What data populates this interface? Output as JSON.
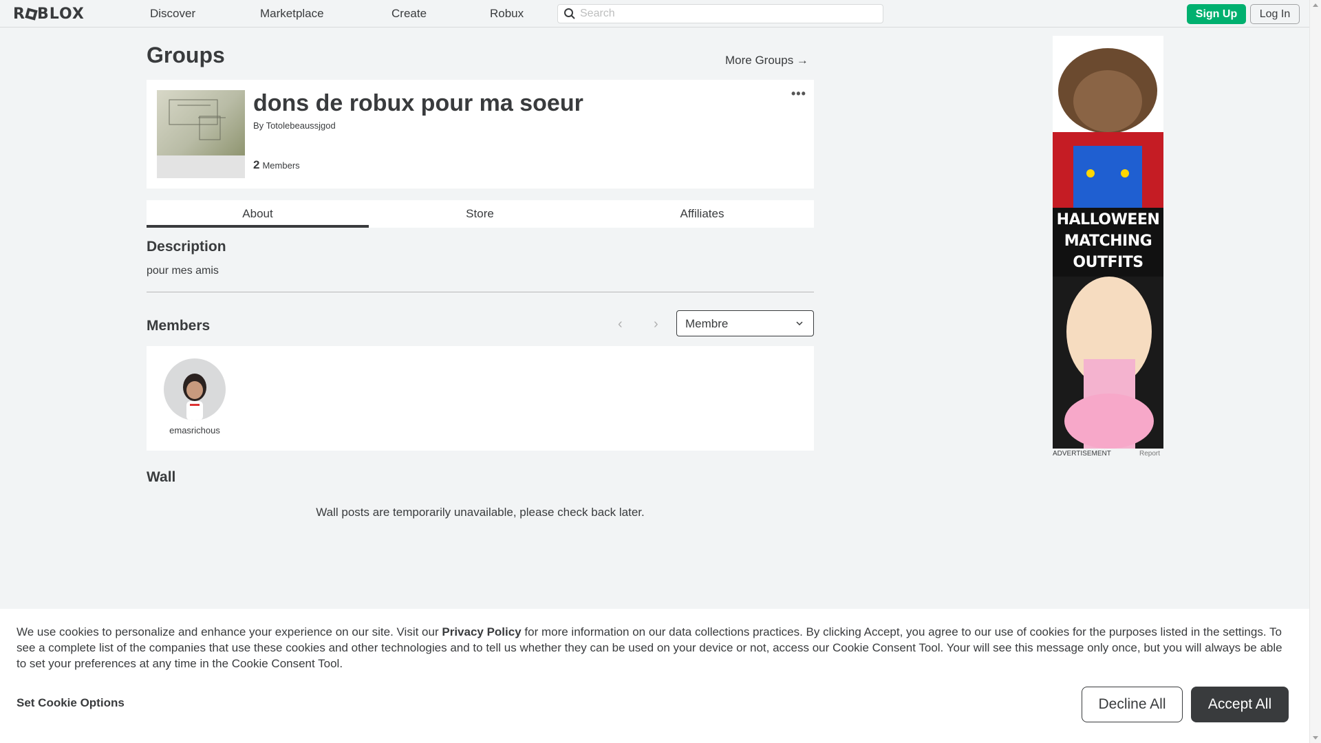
{
  "nav": {
    "logo": "ROBLOX",
    "links": [
      "Discover",
      "Marketplace",
      "Create",
      "Robux"
    ],
    "search_placeholder": "Search",
    "signup": "Sign Up",
    "login": "Log In"
  },
  "page": {
    "heading": "Groups",
    "more_groups": "More Groups →"
  },
  "group": {
    "name": "dons de robux pour ma soeur",
    "by_prefix": "By",
    "owner": "Totolebeaussjgod",
    "member_count": "2",
    "member_label": "Members",
    "menu_icon": "more-dots-icon"
  },
  "tabs": [
    {
      "label": "About",
      "active": true
    },
    {
      "label": "Store",
      "active": false
    },
    {
      "label": "Affiliates",
      "active": false
    }
  ],
  "description": {
    "heading": "Description",
    "text": "pour mes amis"
  },
  "members": {
    "heading": "Members",
    "role_selected": "Membre",
    "list": [
      {
        "username": "emasrichous"
      }
    ]
  },
  "wall": {
    "heading": "Wall",
    "message": "Wall posts are temporarily unavailable, please check back later."
  },
  "ad": {
    "lines": [
      "HALLOWEEN",
      "MATCHING",
      "OUTFITS"
    ],
    "label": "ADVERTISEMENT",
    "report": "Report"
  },
  "cookie": {
    "text_before": "We use cookies to personalize and enhance your experience on our site. Visit our ",
    "privacy_link": "Privacy Policy",
    "text_after": " for more information on our data collections practices. By clicking Accept, you agree to our use of cookies for the purposes listed in the settings. To see a complete list of the companies that use these cookies and other technologies and to tell us whether they can be used on your device or not, access our Cookie Consent Tool. Your will see this message only once, but you will always be able to set your preferences at any time in the Cookie Consent Tool.",
    "set_options": "Set Cookie Options",
    "decline": "Decline All",
    "accept": "Accept All"
  },
  "colors": {
    "signup_green": "#00b06f",
    "dark": "#393b3d",
    "background": "#f2f4f5",
    "ad_red": "#c51c24"
  }
}
